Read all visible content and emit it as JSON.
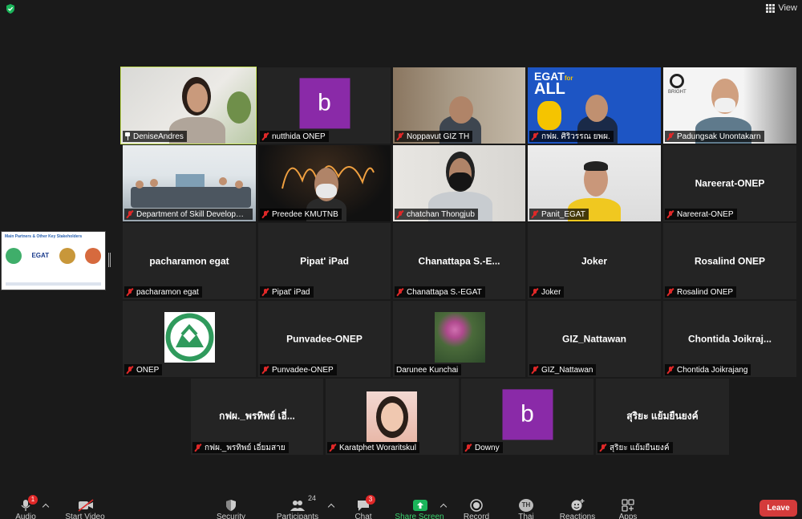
{
  "top": {
    "view_label": "View"
  },
  "colors": {
    "active_border": "#c9e55a",
    "mute_red": "#e02828",
    "avatar_purple": "#8a2aa8",
    "leave_red": "#d43b3b",
    "bg": "#1a1a1a",
    "tile_bg": "#242424"
  },
  "shared_screen": {
    "title": "Main Partners & Other Key Stakeholders",
    "logo_text": "EGAT"
  },
  "participants": [
    {
      "label": "DeniseAndres",
      "video": "webcam-woman",
      "pinned": true
    },
    {
      "label": "nutthida ONEP",
      "avatar_letter": "b"
    },
    {
      "label": "Noppavut GIZ TH",
      "video": "webcam-man"
    },
    {
      "label": "กฟผ. ศิริวรรณ ยพผ.",
      "video": "egat-background",
      "bg_text_1": "EGAT",
      "bg_text_2": "for",
      "bg_text_3": "ALL"
    },
    {
      "label": "Padungsak Unontakarn",
      "video": "bright-background",
      "bg_text_1": "BRIGHT"
    },
    {
      "label": "Department of Skill Development",
      "video": "meeting-room"
    },
    {
      "label": "Preedee KMUTNB",
      "video": "sparkler"
    },
    {
      "label": "chatchan Thongjub",
      "video": "webcam-man-mask"
    },
    {
      "label": "Panit_EGAT",
      "video": "webcam-man-yellow"
    },
    {
      "label": "Nareerat-ONEP",
      "center_name": "Nareerat-ONEP"
    },
    {
      "label": "pacharamon egat",
      "center_name": "pacharamon egat"
    },
    {
      "label": "Pipat' iPad",
      "center_name": "Pipat' iPad"
    },
    {
      "label": "Chanattapa S.-EGAT",
      "center_name": "Chanattapa  S.-E..."
    },
    {
      "label": "Joker",
      "center_name": "Joker"
    },
    {
      "label": "Rosalind ONEP",
      "center_name": "Rosalind ONEP"
    },
    {
      "label": "ONEP",
      "video": "onep-logo"
    },
    {
      "label": "Punvadee-ONEP",
      "center_name": "Punvadee-ONEP"
    },
    {
      "label": "Darunee Kunchai",
      "video": "lotus-photo",
      "unmuted": true
    },
    {
      "label": "GIZ_Nattawan",
      "center_name": "GIZ_Nattawan"
    },
    {
      "label": "Chontida Joikrajang",
      "center_name": "Chontida  Joikraj..."
    },
    {
      "label": "กฟผ._พรทิพย์ เอี่ยมสาย",
      "center_name": "กฟผ._พรทิพย์ เอี่..."
    },
    {
      "label": "Karatphet Woraritskul",
      "video": "profile-photo"
    },
    {
      "label": "Downy",
      "avatar_letter": "b"
    },
    {
      "label": "สุริยะ แย้มยืนยงค์",
      "center_name": "สุริยะ แย้มยืนยงค์"
    }
  ],
  "toolbar": {
    "audio": "Audio",
    "audio_badge": "1",
    "start_video": "Start Video",
    "security": "Security",
    "participants": "Participants",
    "participants_count": "24",
    "chat": "Chat",
    "chat_badge": "3",
    "share_screen": "Share Screen",
    "record": "Record",
    "thai": "Thai",
    "thai_avatar": "TH",
    "reactions": "Reactions",
    "apps": "Apps",
    "leave": "Leave"
  }
}
